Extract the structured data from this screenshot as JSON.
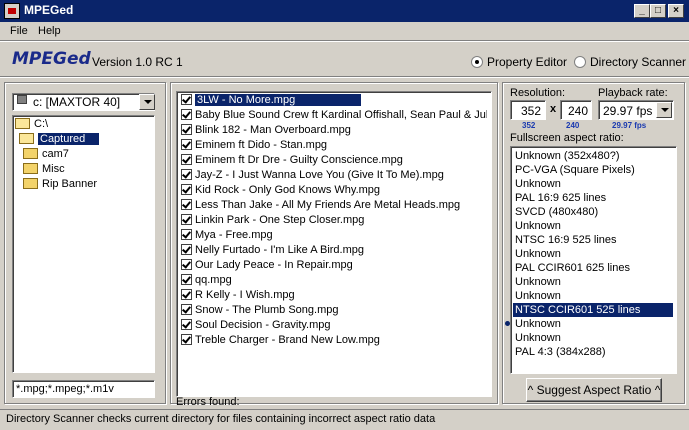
{
  "window": {
    "title": "MPEGed",
    "buttons": [
      "_",
      "□",
      "×"
    ]
  },
  "menu": {
    "items": [
      "File",
      "Help"
    ]
  },
  "header": {
    "logo": "MPEGed",
    "version": "Version 1.0 RC 1",
    "modes": [
      {
        "label": "Property Editor",
        "selected": true
      },
      {
        "label": "Directory Scanner",
        "selected": false
      }
    ]
  },
  "drive": {
    "value": "c: [MAXTOR 40]"
  },
  "tree": [
    {
      "label": "C:\\",
      "open": true,
      "selected": false
    },
    {
      "label": "Captured",
      "open": true,
      "selected": true
    },
    {
      "label": "cam7",
      "open": false,
      "selected": false
    },
    {
      "label": "Misc",
      "open": false,
      "selected": false
    },
    {
      "label": "Rip Banner",
      "open": false,
      "selected": false
    }
  ],
  "filter": {
    "value": "*.mpg;*.mpeg;*.m1v"
  },
  "files": [
    {
      "label": "3LW - No More.mpg",
      "selected": true
    },
    {
      "label": "Baby Blue Sound Crew ft Kardinal Offishall, Sean Paul & Jully -",
      "selected": false
    },
    {
      "label": "Blink 182 - Man Overboard.mpg",
      "selected": false
    },
    {
      "label": "Eminem ft Dido - Stan.mpg",
      "selected": false
    },
    {
      "label": "Eminem ft Dr Dre - Guilty Conscience.mpg",
      "selected": false
    },
    {
      "label": "Jay-Z - I Just Wanna Love You (Give It To Me).mpg",
      "selected": false
    },
    {
      "label": "Kid Rock - Only God Knows Why.mpg",
      "selected": false
    },
    {
      "label": "Less Than Jake - All My Friends Are Metal Heads.mpg",
      "selected": false
    },
    {
      "label": "Linkin Park - One Step Closer.mpg",
      "selected": false
    },
    {
      "label": "Mya - Free.mpg",
      "selected": false
    },
    {
      "label": "Nelly Furtado - I'm Like A Bird.mpg",
      "selected": false
    },
    {
      "label": "Our Lady Peace - In Repair.mpg",
      "selected": false
    },
    {
      "label": "qq.mpg",
      "selected": false
    },
    {
      "label": "R Kelly - I Wish.mpg",
      "selected": false
    },
    {
      "label": "Snow - The Plumb Song.mpg",
      "selected": false
    },
    {
      "label": "Soul Decision - Gravity.mpg",
      "selected": false
    },
    {
      "label": "Treble Charger - Brand New Low.mpg",
      "selected": false
    }
  ],
  "errors": {
    "label": "Errors found:"
  },
  "resolution": {
    "label": "Resolution:",
    "width": "352",
    "height": "240",
    "sep": "x",
    "width_hint": "352",
    "height_hint": "240"
  },
  "playback": {
    "label": "Playback rate:",
    "value": "29.97 fps",
    "hint": "29.97 fps"
  },
  "aspect": {
    "label": "Fullscreen aspect ratio:",
    "items": [
      {
        "label": "Unknown (352x480?)",
        "selected": false
      },
      {
        "label": "PC-VGA (Square Pixels)",
        "selected": false
      },
      {
        "label": "Unknown",
        "selected": false
      },
      {
        "label": "PAL 16:9 625 lines",
        "selected": false
      },
      {
        "label": "SVCD (480x480)",
        "selected": false
      },
      {
        "label": "Unknown",
        "selected": false
      },
      {
        "label": "NTSC 16:9 525 lines",
        "selected": false
      },
      {
        "label": "Unknown",
        "selected": false
      },
      {
        "label": "PAL CCIR601 625 lines",
        "selected": false
      },
      {
        "label": "Unknown",
        "selected": false
      },
      {
        "label": "Unknown",
        "selected": false
      },
      {
        "label": "NTSC CCIR601 525 lines",
        "selected": true
      },
      {
        "label": "Unknown",
        "selected": false
      },
      {
        "label": "Unknown",
        "selected": false
      },
      {
        "label": "PAL 4:3 (384x288)",
        "selected": false
      }
    ],
    "suggest_button": "^ Suggest Aspect Ratio ^"
  },
  "status": {
    "text": "Directory Scanner checks current directory for files containing incorrect aspect ratio data"
  },
  "colors": {
    "titlebar": "#0a246a",
    "selection": "#0a246a",
    "face": "#d4d0c8",
    "logo": "#1a2a8a",
    "hint_blue": "#1a3ab0"
  }
}
